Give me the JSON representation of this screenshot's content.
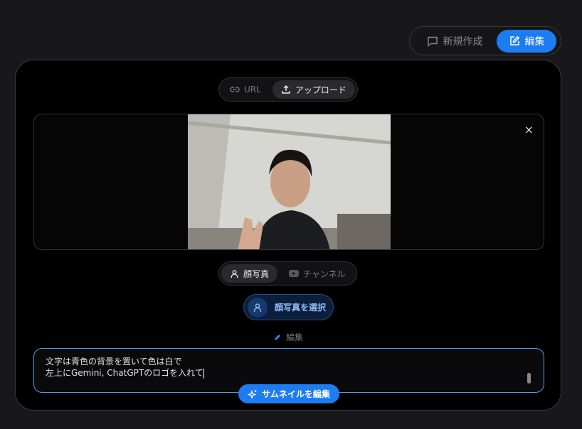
{
  "mode_switch": {
    "new_label": "新規作成",
    "edit_label": "編集"
  },
  "source_tabs": {
    "url_label": "URL",
    "upload_label": "アップロード"
  },
  "preview": {
    "close_label": "×"
  },
  "face_tabs": {
    "face_label": "顔写真",
    "channel_label": "チャンネル"
  },
  "select_face_label": "顔写真を選択",
  "edit_section_label": "編集",
  "prompt": {
    "lines": [
      "文字は青色の背景を置いて色は白で",
      "左上にGemini, ChatGPTのロゴを入れて"
    ]
  },
  "generate_label": "サムネイルを編集",
  "colors": {
    "accent": "#1e7cf2"
  }
}
